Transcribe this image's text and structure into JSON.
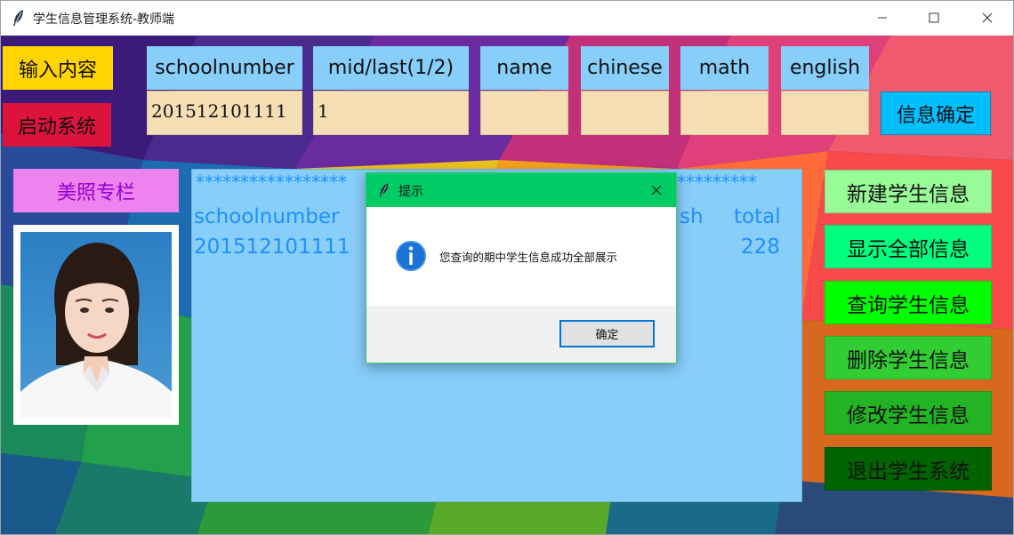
{
  "window": {
    "title": "学生信息管理系统-教师端"
  },
  "left_labels": {
    "input_label": "输入内容",
    "start_button": "启动系统"
  },
  "headers": [
    "schoolnumber",
    "mid/last(1/2)",
    "name",
    "chinese",
    "math",
    "english"
  ],
  "inputs": [
    "201512101111",
    "1",
    "",
    "",
    "",
    ""
  ],
  "confirm_button": "信息确定",
  "photo": {
    "label": "美照专栏"
  },
  "display": {
    "stars_left": "*****************",
    "stars_right": "*********",
    "col_left_header": "schoolnumber",
    "col_left_value": "201512101111",
    "col_mid_header": "sh",
    "col_right_header": "total",
    "col_right_value": "228"
  },
  "side_buttons": [
    {
      "label": "新建学生信息",
      "color": "#98fb98"
    },
    {
      "label": "显示全部信息",
      "color": "#00ff7f"
    },
    {
      "label": "查询学生信息",
      "color": "#00ff00"
    },
    {
      "label": "删除学生信息",
      "color": "#32cd32"
    },
    {
      "label": "修改学生信息",
      "color": "#22b422"
    },
    {
      "label": "退出学生系统",
      "color": "#006400"
    }
  ],
  "dialog": {
    "title": "提示",
    "message": "您查询的期中学生信息成功全部展示",
    "ok_label": "确定",
    "title_color": "#00cc66"
  },
  "icons": {
    "app": "feather-icon",
    "dialog_info": "info-icon"
  }
}
